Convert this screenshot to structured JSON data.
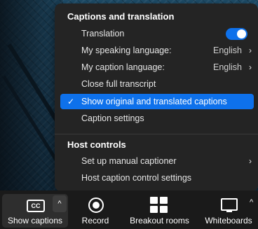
{
  "menu": {
    "section1_title": "Captions and translation",
    "translation_label": "Translation",
    "translation_enabled": true,
    "speaking_language_label": "My speaking language:",
    "speaking_language_value": "English",
    "caption_language_label": "My caption language:",
    "caption_language_value": "English",
    "close_transcript_label": "Close full transcript",
    "show_both_label": "Show original and translated captions",
    "caption_settings_label": "Caption settings",
    "section2_title": "Host controls",
    "manual_captioner_label": "Set up manual captioner",
    "host_caption_settings_label": "Host caption control settings"
  },
  "toolbar": {
    "cc_text": "CC",
    "show_captions_label": "Show captions",
    "record_label": "Record",
    "breakout_label": "Breakout rooms",
    "whiteboards_label": "Whiteboards"
  },
  "colors": {
    "accent": "#0e71eb",
    "menu_bg": "#242424",
    "toolbar_bg": "#1a1a1a"
  }
}
